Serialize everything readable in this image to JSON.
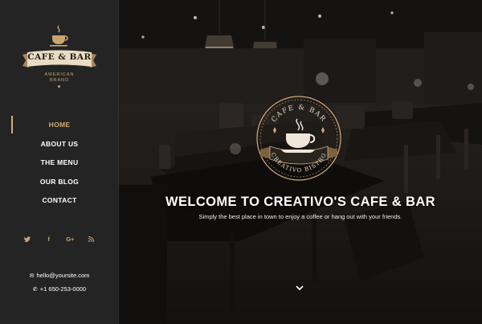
{
  "brand": {
    "name": "CAFE & BAR",
    "subtitle_line1": "AMERICAN",
    "subtitle_line2": "BRAND"
  },
  "nav": {
    "items": [
      {
        "label": "HOME",
        "active": true
      },
      {
        "label": "ABOUT US",
        "active": false
      },
      {
        "label": "THE MENU",
        "active": false
      },
      {
        "label": "OUR BLOG",
        "active": false
      },
      {
        "label": "CONTACT",
        "active": false
      }
    ]
  },
  "social": {
    "twitter": "🐦",
    "facebook": "f",
    "googleplus": "G+",
    "rss": "⟟"
  },
  "contact": {
    "email": "hello@yoursite.com",
    "phone": "+1 650-253-0000"
  },
  "emblem": {
    "top_text": "CAFE & BAR",
    "bottom_text": "CREATIVO BISTRO"
  },
  "hero": {
    "headline": "WELCOME TO CREATIVO'S CAFE & BAR",
    "tagline": "Simply the best place in town to enjoy a coffee or hang out with your friends."
  },
  "colors": {
    "accent": "#d2ab77",
    "sidebar_bg": "#242424",
    "text": "#ffffff"
  },
  "icons": {
    "logo": "coffee-cup-icon",
    "email": "envelope-icon",
    "phone": "phone-icon",
    "scroll": "chevron-down-icon"
  }
}
